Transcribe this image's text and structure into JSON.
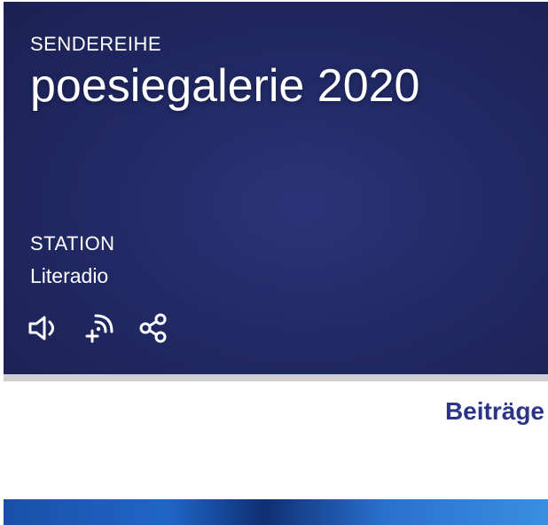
{
  "series": {
    "kicker": "SENDEREIHE",
    "title": "poesiegalerie 2020"
  },
  "station": {
    "label": "STATION",
    "name": "Literadio"
  },
  "actions": {
    "items": [
      {
        "icon": "speaker-icon"
      },
      {
        "icon": "add-podcast-icon"
      },
      {
        "icon": "share-icon"
      }
    ]
  },
  "section": {
    "heading": "Beiträge"
  },
  "colors": {
    "hero_background": "#222a66",
    "accent": "#2b3487",
    "divider": "#cfcfd3"
  }
}
